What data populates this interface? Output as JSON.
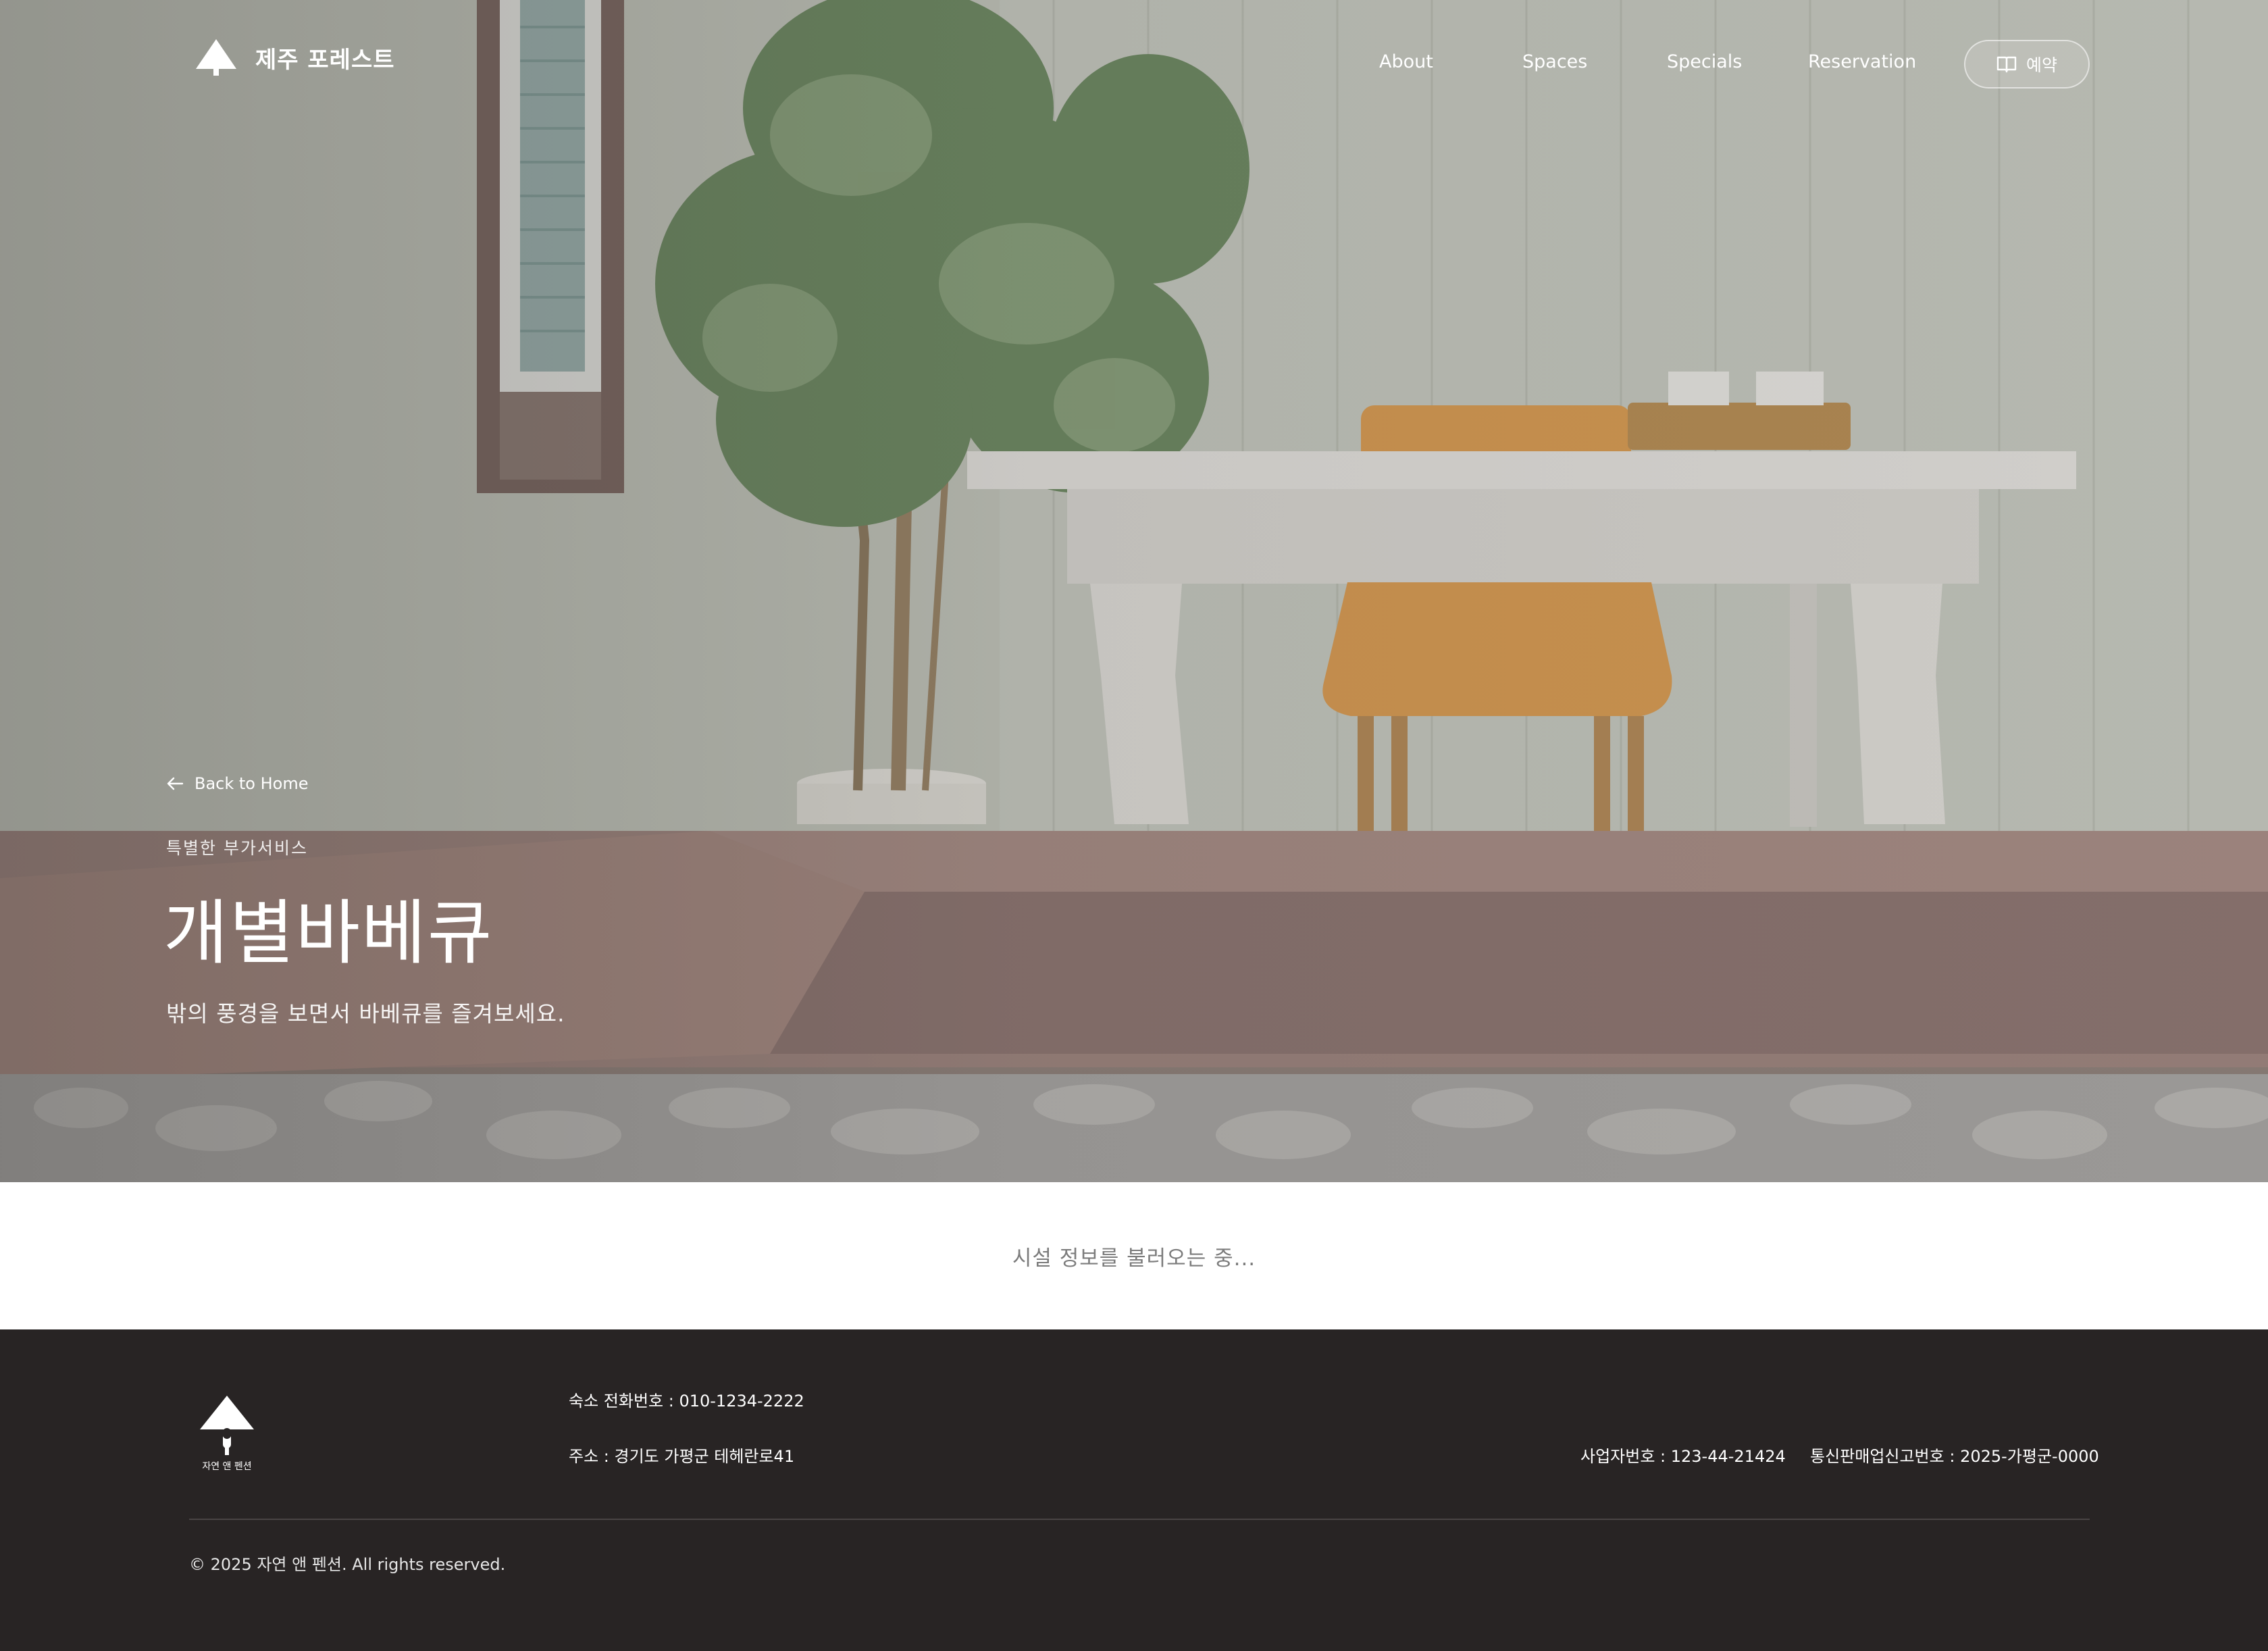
{
  "nav": {
    "brand_name": "제주 포레스트",
    "links": [
      "About",
      "Spaces",
      "Specials",
      "Reservation"
    ],
    "reserve_button": "예약"
  },
  "hero": {
    "back_link": "Back to Home",
    "eyebrow": "특별한 부가서비스",
    "title": "개별바베큐",
    "subtitle": "밖의 풍경을 보면서 바베큐를 즐겨보세요."
  },
  "content": {
    "loading_text": "시설 정보를 불러오는 중..."
  },
  "footer": {
    "logo_text": "자연 앤 펜션",
    "phone": "숙소 전화번호 : 010-1234-2222",
    "address": "주소 : 경기도 가평군 테헤란로41",
    "business_number": "사업자번호 : 123-44-21424",
    "ecommerce_number": "통신판매업신고번호 : 2025-가평군-0000",
    "copyright": "© 2025 자연 앤 펜션. All rights reserved."
  },
  "colors": {
    "footer_bg": "#282424",
    "loading_text": "#7c7c7c",
    "hero_text": "#ffffff"
  },
  "icons": [
    "tree-logo-icon",
    "book-icon",
    "arrow-left-icon"
  ]
}
